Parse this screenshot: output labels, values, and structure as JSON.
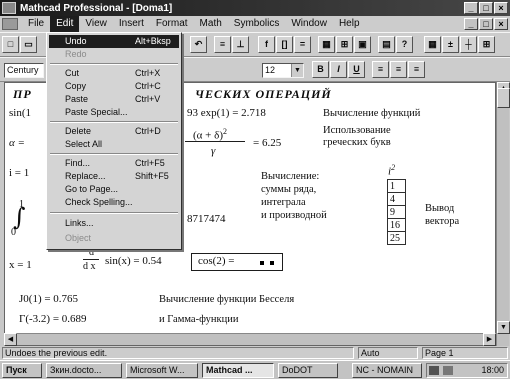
{
  "window": {
    "title": "Mathcad Professional - [Doma1]",
    "controls": [
      "_",
      "□",
      "×"
    ],
    "doc_controls": [
      "_",
      "□",
      "×"
    ]
  },
  "menubar": [
    "File",
    "Edit",
    "View",
    "Insert",
    "Format",
    "Math",
    "Symbolics",
    "Window",
    "Help"
  ],
  "toolbar": {
    "font_combo": "Century",
    "size_combo": "12",
    "style_bold": "B",
    "style_italic": "I",
    "style_underline": "U"
  },
  "edit_menu": {
    "items": [
      {
        "label": "Undo",
        "shortcut": "Alt+Bksp",
        "state": "highlighted"
      },
      {
        "label": "Redo",
        "shortcut": "",
        "state": "disabled"
      },
      {
        "label": "Cut",
        "shortcut": "Ctrl+X",
        "state": "normal"
      },
      {
        "label": "Copy",
        "shortcut": "Ctrl+C",
        "state": "normal"
      },
      {
        "label": "Paste",
        "shortcut": "Ctrl+V",
        "state": "normal"
      },
      {
        "label": "Paste Special...",
        "shortcut": "",
        "state": "normal"
      },
      {
        "label": "Delete",
        "shortcut": "Ctrl+D",
        "state": "normal"
      },
      {
        "label": "Select All",
        "shortcut": "",
        "state": "normal"
      },
      {
        "label": "Find...",
        "shortcut": "Ctrl+F5",
        "state": "normal"
      },
      {
        "label": "Replace...",
        "shortcut": "Shift+F5",
        "state": "normal"
      },
      {
        "label": "Go to Page...",
        "shortcut": "",
        "state": "normal"
      },
      {
        "label": "Check Spelling...",
        "shortcut": "",
        "state": "normal"
      },
      {
        "label": "Links...",
        "shortcut": "",
        "state": "normal"
      },
      {
        "label": "Object",
        "shortcut": "",
        "state": "disabled"
      }
    ]
  },
  "document": {
    "heading": "ЧЕСКИХ ОПЕРАЦИЙ",
    "heading_left": "ПР",
    "row1_math_left": "sin(1",
    "row1_math_mid": "93  exp(1) = 2.718",
    "row1_label": "Вычисление функций",
    "row2_math_left": "α = ",
    "row2_numerator": "(α + δ)",
    "row2_exp": "2",
    "row2_denominator": "γ",
    "row2_result": "= 6.25",
    "row2_label_1": "Использование",
    "row2_label_2": "греческих букв",
    "row3_math_left": "i = 1",
    "row3_calc_1": "Вычисление:",
    "row3_calc_2": "суммы ряда,",
    "row3_calc_3": "интеграла",
    "row3_calc_4": "и производной",
    "vector_header": "i",
    "vector_header_exp": "2",
    "vector_values": [
      "1",
      "4",
      "9",
      "16",
      "25"
    ],
    "vector_label_1": "Вывод",
    "vector_label_2": "вектора",
    "integral_top": "1",
    "integral_bottom": "0",
    "integral_result": "8717474",
    "deriv_x": "x = 1",
    "deriv_num": "d",
    "deriv_den": "d x",
    "deriv_expr": "sin(x) = 0.54",
    "cos_box": "cos(2) =",
    "bessel_math": "J0(1) = 0.765",
    "bessel_label": "Вычисление функции Бесселя",
    "gamma_math": "Γ(-3.2) = 0.689",
    "gamma_label": "и  Гамма-функции"
  },
  "status": {
    "message": "Undoes the previous edit.",
    "mode": "Auto",
    "page": "Page 1"
  },
  "taskbar": {
    "start": "Пуск",
    "tasks": [
      "Зкин.docto...",
      "Microsoft W...",
      "Mathcad ...",
      "DoDOT",
      "NC - NOMAIN"
    ],
    "clock": "18:00"
  }
}
